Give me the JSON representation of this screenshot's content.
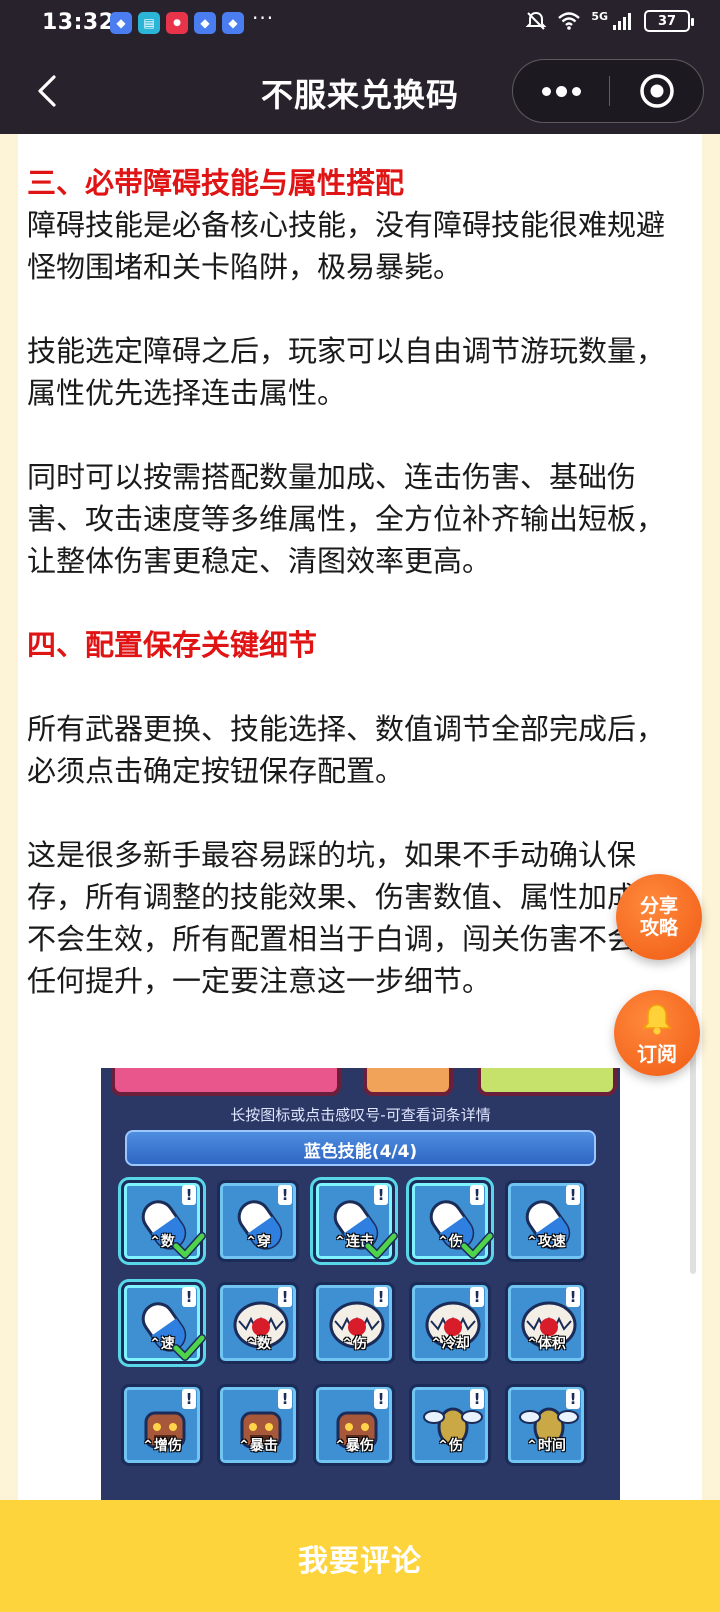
{
  "status_bar": {
    "time": "13:32",
    "more": "···",
    "network": "5G",
    "battery": "37"
  },
  "title_bar": {
    "title": "不服来兑换码"
  },
  "article": {
    "heading3": "三、必带障碍技能与属性搭配",
    "p1": "障碍技能是必备核心技能，没有障碍技能很难规避怪物围堵和关卡陷阱，极易暴毙。",
    "p2": "技能选定障碍之后，玩家可以自由调节游玩数量，属性优先选择连击属性。",
    "p3": "同时可以按需搭配数量加成、连击伤害、基础伤害、攻击速度等多维属性，全方位补齐输出短板，让整体伤害更稳定、清图效率更高。",
    "heading4": "四、配置保存关键细节",
    "p4": "所有武器更换、技能选择、数值调节全部完成后，必须点击确定按钮保存配置。",
    "p5": "这是很多新手最容易踩的坑，如果不手动确认保存，所有调整的技能效果、伤害数值、属性加成都不会生效，所有配置相当于白调，闯关伤害不会有任何提升，一定要注意这一步细节。"
  },
  "game_screenshot": {
    "hint": "长按图标或点击感叹号-可查看词条详情",
    "section_title": "蓝色技能(4/4)",
    "skills": [
      {
        "label": "数",
        "type": "capsule",
        "selected": true
      },
      {
        "label": "穿",
        "type": "capsule",
        "selected": false
      },
      {
        "label": "连击",
        "type": "capsule",
        "selected": true
      },
      {
        "label": "伤",
        "type": "capsule",
        "selected": true
      },
      {
        "label": "攻速",
        "type": "capsule",
        "selected": false
      },
      {
        "label": "速",
        "type": "capsule",
        "selected": true
      },
      {
        "label": "数",
        "type": "trap",
        "selected": false
      },
      {
        "label": "伤",
        "type": "trap",
        "selected": false
      },
      {
        "label": "冷却",
        "type": "trap",
        "selected": false
      },
      {
        "label": "体积",
        "type": "trap",
        "selected": false
      },
      {
        "label": "增伤",
        "type": "totem",
        "selected": false
      },
      {
        "label": "暴击",
        "type": "totem",
        "selected": false
      },
      {
        "label": "暴伤",
        "type": "totem",
        "selected": false
      },
      {
        "label": "伤",
        "type": "drone",
        "selected": false
      },
      {
        "label": "时间",
        "type": "drone",
        "selected": false
      }
    ]
  },
  "floating": {
    "share_line1": "分享",
    "share_line2": "攻略",
    "subscribe": "订阅"
  },
  "bottom_bar": {
    "comment": "我要评论"
  },
  "colors": {
    "title_bar_bg": "#27222c",
    "heading_red": "#e01414",
    "bottom_bar_yellow": "#fdd43b",
    "fab_orange": "#f05a14"
  }
}
